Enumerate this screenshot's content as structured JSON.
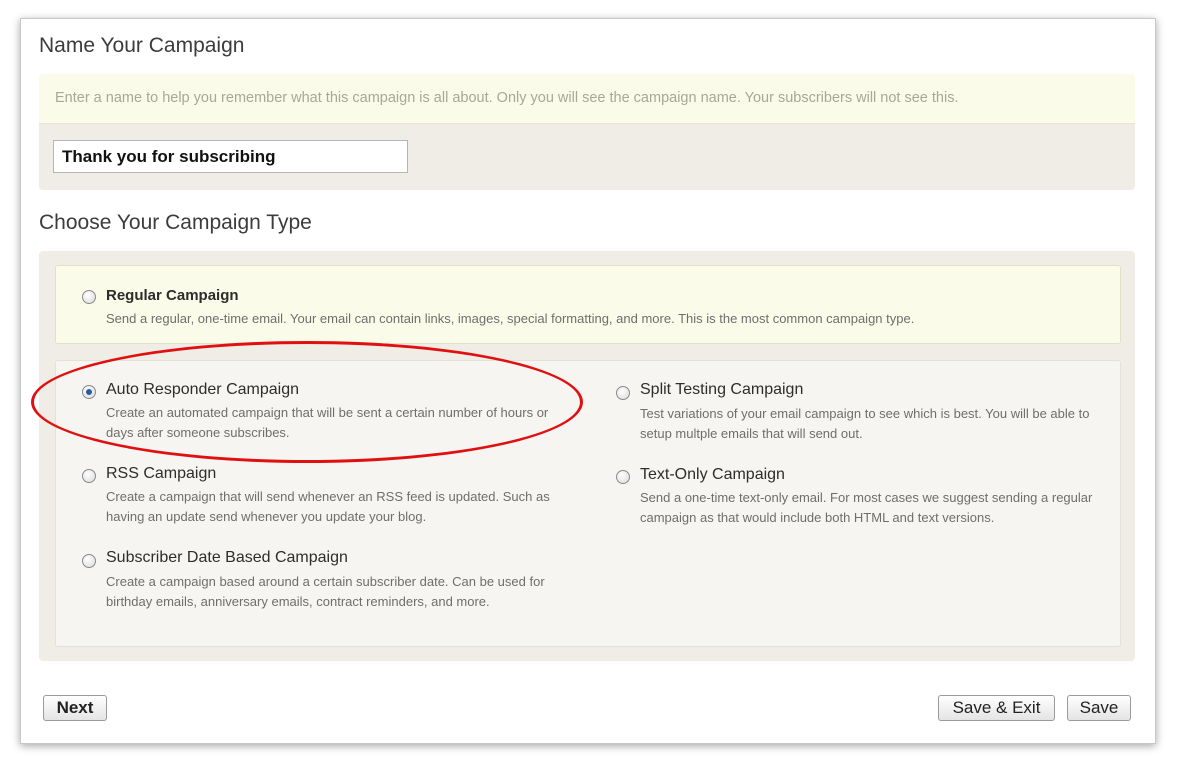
{
  "name_section": {
    "heading": "Name Your Campaign",
    "hint": "Enter a name to help you remember what this campaign is all about. Only you will see the campaign name. Your subscribers will not see this.",
    "input_value": "Thank you for subscribing"
  },
  "type_section": {
    "heading": "Choose Your Campaign Type",
    "options": [
      {
        "title": "Regular Campaign",
        "description": "Send a regular, one-time email. Your email can contain links, images, special formatting, and more. This is the most common campaign type.",
        "selected": false
      },
      {
        "title": "Auto Responder Campaign",
        "description": "Create an automated campaign that will be sent a certain number of hours or days after someone subscribes.",
        "selected": true
      },
      {
        "title": "Split Testing Campaign",
        "description": "Test variations of your email campaign to see which is best. You will be able to setup multple emails that will send out.",
        "selected": false
      },
      {
        "title": "RSS Campaign",
        "description": "Create a campaign that will send whenever an RSS feed is updated. Such as having an update send whenever you update your blog.",
        "selected": false
      },
      {
        "title": "Text-Only Campaign",
        "description": "Send a one-time text-only email. For most cases we suggest sending a regular campaign as that would include both HTML and text versions.",
        "selected": false
      },
      {
        "title": "Subscriber Date Based Campaign",
        "description": "Create a campaign based around a certain subscriber date. Can be used for birthday emails, anniversary emails, contract reminders, and more.",
        "selected": false
      }
    ]
  },
  "buttons": {
    "next": "Next",
    "save_exit": "Save & Exit",
    "save": "Save"
  },
  "colors": {
    "highlight": "#e01010",
    "panel_bg": "#efede6",
    "hint_bg": "#fbfbe9",
    "radio_dot": "#2c5aa0"
  }
}
